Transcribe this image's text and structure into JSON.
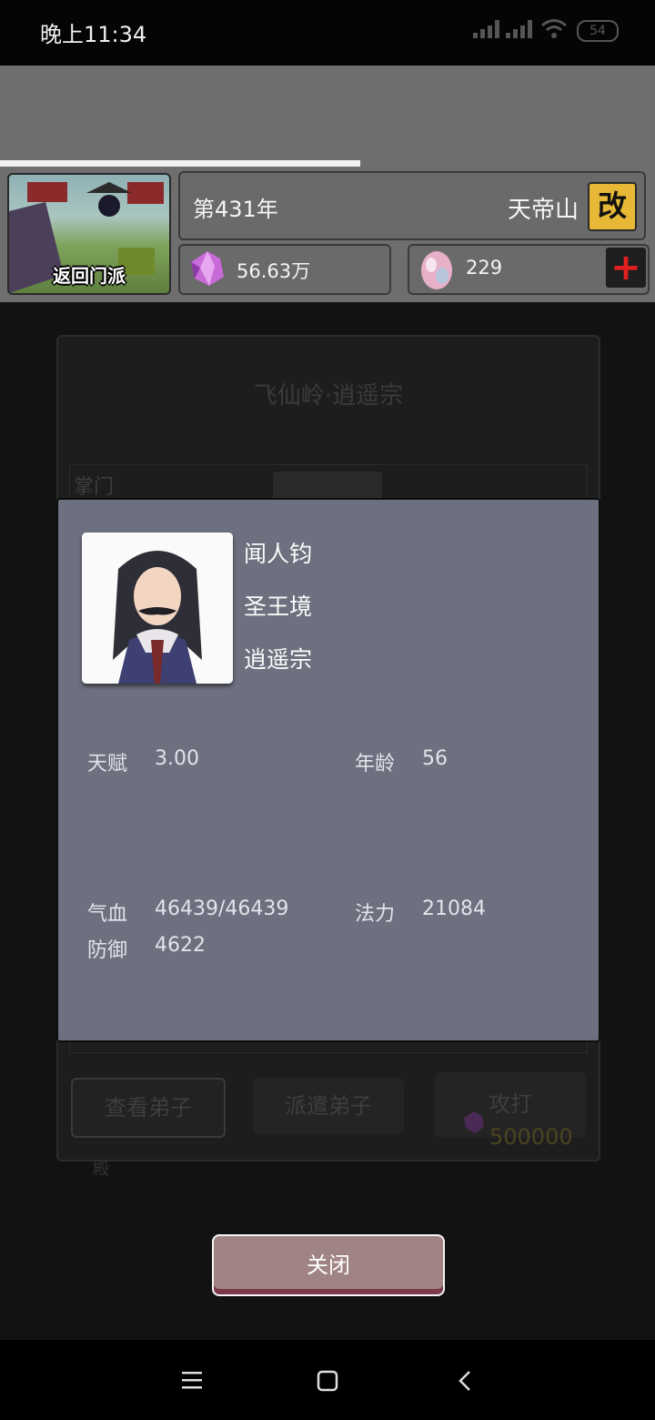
{
  "status_bar": {
    "time": "晚上11:34",
    "battery": "54"
  },
  "header": {
    "sect_thumb_label": "返回门派",
    "year": "第431年",
    "mountain": "天帝山",
    "change_label": "改",
    "crystals": "56.63万",
    "gems": "229",
    "plus_label": "+"
  },
  "background_dialog": {
    "title": "飞仙岭·逍遥宗",
    "leader_label": "掌门",
    "buttons": {
      "view": "查看弟子",
      "dispatch": "派遣弟子",
      "attack": "攻打",
      "attack_cost": "500000"
    },
    "footer_char": "殿"
  },
  "character": {
    "name": "闻人钧",
    "realm": "圣王境",
    "sect": "逍遥宗",
    "stats": {
      "talent_label": "天赋",
      "talent": "3.00",
      "age_label": "年龄",
      "age": "56",
      "hp_label": "气血",
      "hp": "46439/46439",
      "mana_label": "法力",
      "mana": "21084",
      "defense_label": "防御",
      "defense": "4622"
    }
  },
  "close_label": "关闭",
  "colors": {
    "popup_bg": "#6d707e",
    "close_bg": "#a08484",
    "change_bg": "#e7b836"
  },
  "icons": [
    "signal-icon",
    "wifi-icon",
    "battery-icon",
    "crystal-icon",
    "gem-icon",
    "menu-icon",
    "home-icon",
    "back-icon"
  ]
}
